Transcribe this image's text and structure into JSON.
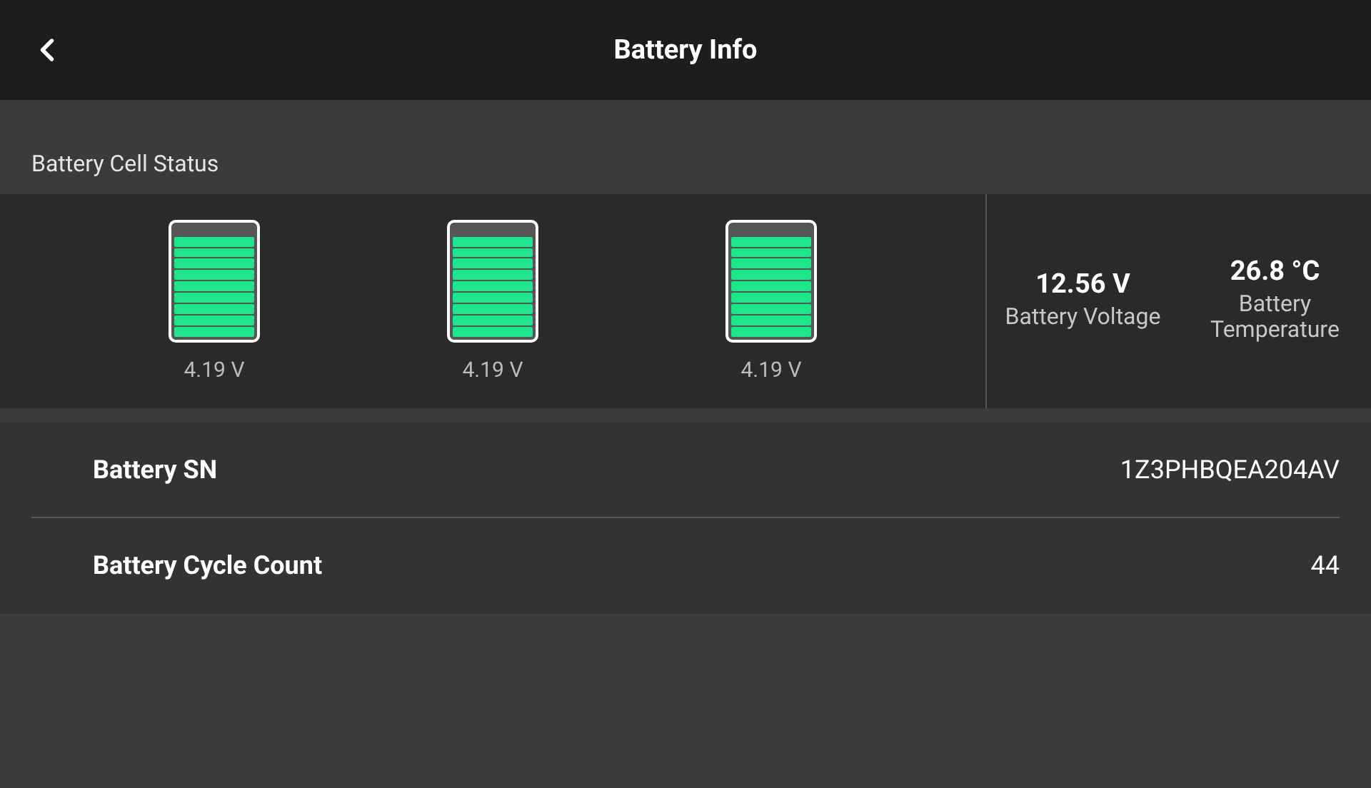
{
  "header": {
    "title": "Battery Info"
  },
  "cell_status": {
    "title": "Battery Cell Status",
    "cells": [
      {
        "level": 0.9,
        "reading": "4.19 V"
      },
      {
        "level": 0.9,
        "reading": "4.19 V"
      },
      {
        "level": 0.9,
        "reading": "4.19 V"
      }
    ],
    "stats": [
      {
        "value": "12.56 V",
        "label": "Battery Voltage"
      },
      {
        "value": "26.8 °C",
        "label": "Battery Temperature"
      }
    ]
  },
  "info_rows": [
    {
      "label": "Battery SN",
      "value": "1Z3PHBQEA204AV"
    },
    {
      "label": "Battery Cycle Count",
      "value": "44"
    }
  ]
}
